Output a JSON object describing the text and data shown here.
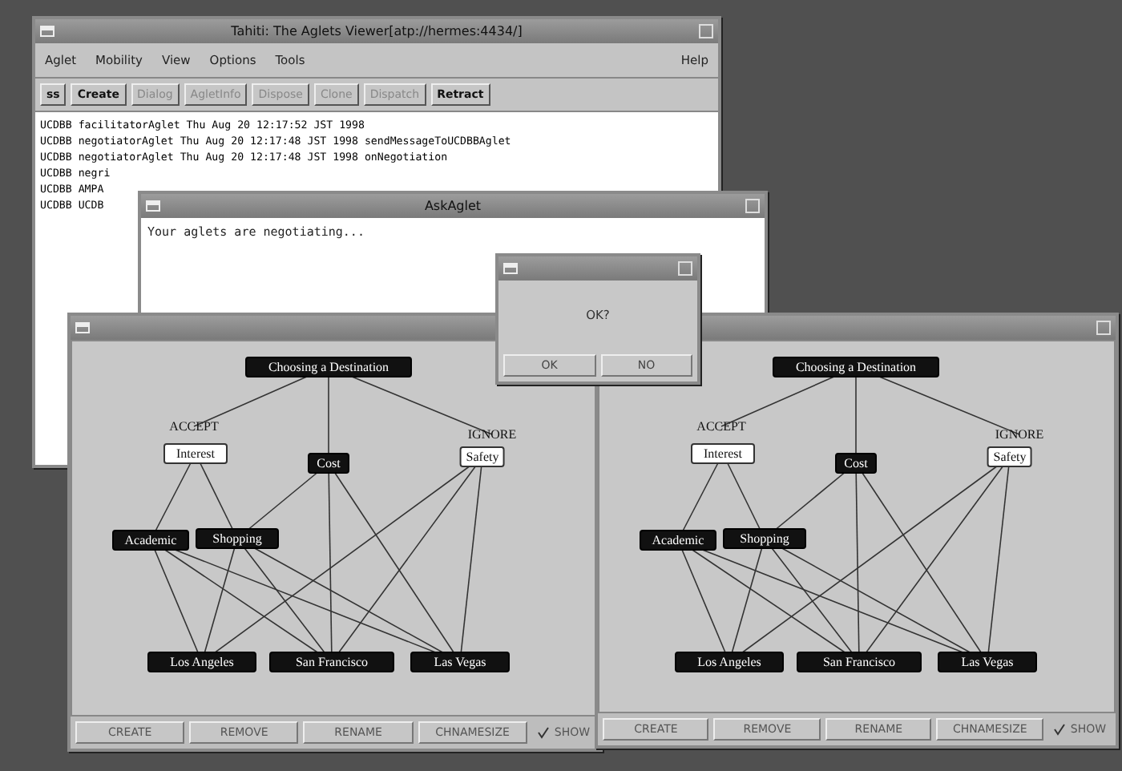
{
  "main_window": {
    "title": "Tahiti: The Aglets Viewer[atp://hermes:4434/]",
    "menu": [
      "Aglet",
      "Mobility",
      "View",
      "Options",
      "Tools"
    ],
    "help_menu": "Help",
    "toolbar": [
      {
        "label": "ss",
        "disabled": false
      },
      {
        "label": "Create",
        "disabled": false
      },
      {
        "label": "Dialog",
        "disabled": true
      },
      {
        "label": "AgletInfo",
        "disabled": true
      },
      {
        "label": "Dispose",
        "disabled": true
      },
      {
        "label": "Clone",
        "disabled": true
      },
      {
        "label": "Dispatch",
        "disabled": true
      },
      {
        "label": "Retract",
        "disabled": false
      }
    ],
    "log": [
      "UCDBB facilitatorAglet Thu Aug 20 12:17:52 JST 1998",
      "UCDBB negotiatorAglet Thu Aug 20 12:17:48 JST 1998 sendMessageToUCDBBAglet",
      "UCDBB negotiatorAglet Thu Aug 20 12:17:48 JST 1998 onNegotiation",
      "UCDBB negri",
      "UCDBB AMPA",
      "UCDBB UCDB"
    ]
  },
  "message_window": {
    "title": "AskAglet",
    "message": "Your aglets are negotiating..."
  },
  "confirm_dialog": {
    "message": "OK?",
    "buttons": [
      "OK",
      "NO"
    ]
  },
  "graph_windows": [
    {
      "nodes": [
        {
          "label": "Choosing a Destination",
          "kind": "filled"
        },
        {
          "label": "ACCEPT",
          "kind": "label"
        },
        {
          "label": "Interest",
          "kind": "outlined"
        },
        {
          "label": "Cost",
          "kind": "filled"
        },
        {
          "label": "IGNORE",
          "kind": "label"
        },
        {
          "label": "Safety",
          "kind": "outlined"
        },
        {
          "label": "Academic",
          "kind": "filled"
        },
        {
          "label": "Shopping",
          "kind": "filled"
        },
        {
          "label": "Los Angeles",
          "kind": "filled"
        },
        {
          "label": "San Francisco",
          "kind": "filled"
        },
        {
          "label": "Las Vegas",
          "kind": "filled"
        }
      ],
      "buttons": [
        "CREATE",
        "REMOVE",
        "RENAME",
        "CHNAMESIZE"
      ],
      "show": {
        "label": "SHOW",
        "checked": true
      }
    },
    {
      "nodes": [
        {
          "label": "Choosing a Destination",
          "kind": "filled"
        },
        {
          "label": "ACCEPT",
          "kind": "label"
        },
        {
          "label": "Interest",
          "kind": "outlined"
        },
        {
          "label": "Cost",
          "kind": "filled"
        },
        {
          "label": "IGNORE",
          "kind": "label"
        },
        {
          "label": "Safety",
          "kind": "outlined"
        },
        {
          "label": "Academic",
          "kind": "filled"
        },
        {
          "label": "Shopping",
          "kind": "filled"
        },
        {
          "label": "Los Angeles",
          "kind": "filled"
        },
        {
          "label": "San Francisco",
          "kind": "filled"
        },
        {
          "label": "Las Vegas",
          "kind": "filled"
        }
      ],
      "buttons": [
        "CREATE",
        "REMOVE",
        "RENAME",
        "CHNAMESIZE"
      ],
      "show": {
        "label": "SHOW",
        "checked": true
      }
    }
  ]
}
